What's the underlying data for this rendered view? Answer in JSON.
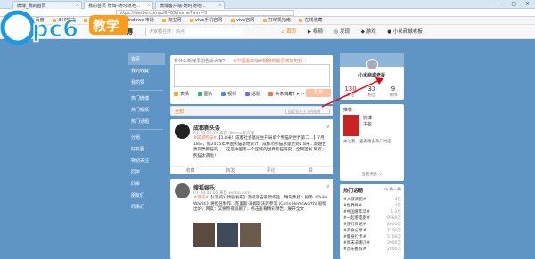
{
  "browser": {
    "tabs": [
      {
        "label": "微博_我的首页"
      },
      {
        "label": "我的首页 微博-随时随地…"
      },
      {
        "label": "微博客户端-随时随地…"
      }
    ],
    "url": "https://weibo.com/u/6465/home?wvr=5",
    "bookmarks": [
      "收藏",
      "百度",
      "360搜索",
      "MSN 导航",
      "Windows 市场",
      "淘宝网",
      "vivo手机官网",
      "vivo官网",
      "打印机指南",
      "在线收藏"
    ]
  },
  "watermark": {
    "text": "pc6",
    "badge": "教学",
    "badge_color": "#ff9c1b"
  },
  "weibo": {
    "logo_text": "微博",
    "search_placeholder": "大家都在搜：热点",
    "nav": [
      "首页",
      "视频",
      "发现",
      "游戏",
      "小米商城老板"
    ],
    "nav_active": 0
  },
  "sidebar": {
    "items": [
      "首页",
      "我的收藏",
      "我的赞",
      "热门微博",
      "热门视频",
      "热门话题",
      "分组",
      "好友圈",
      "特别关注",
      "同学",
      "同事",
      "朋友们",
      "同事们"
    ]
  },
  "compose": {
    "title": "有什么新鲜事想告诉大家？",
    "hot_topic": "#中国嘉年华#聊聊你最喜欢的电影→",
    "tools": [
      {
        "label": "表情",
        "color": "#f5a623"
      },
      {
        "label": "图片",
        "color": "#3cb371"
      },
      {
        "label": "视频",
        "color": "#4a90d9"
      },
      {
        "label": "话题",
        "color": "#7b68ee"
      },
      {
        "label": "头条文章",
        "color": "#eb7350"
      },
      {
        "label": "···",
        "color": "#cccccc"
      }
    ],
    "visibility": "公开",
    "publish_label": "发布"
  },
  "filter": {
    "label": "全部",
    "search_placeholder": "搜索我关注人的微博"
  },
  "posts": [
    {
      "name": "成都新头条",
      "meta": "07-18 08:11 来自 iPhone客户端",
      "keyword": "#成都熊猫#",
      "text": "【1.8米！成都社会基层生开局单个熊猫的世界第二…】7月18日，据2015年中国熊猫基地统计，成都市熊猫总量达到1.8米…超越世界同类熊猫的……这是中国第一个区域的世界熊猫研究…全网首发 网友：熊猫太萌啦！",
      "actions": [
        "收藏",
        "转发",
        "评论",
        "赞"
      ]
    },
    {
      "name": "搜狐娱乐",
      "meta": "07-18 08:05 来自 weibo.com",
      "keyword": "#漫威#",
      "text": "【《漫威》新剧发布】漫威宇宙最新作品，精彩集结：据悉《Taika Waititi》将担任制作…克里斯·海姆斯沃斯参演 (Chris Hemsworth) 剧情出炉，网友：又要熬夜追剧了，点击查看精彩预告…展开全文",
      "actions": [
        "收藏",
        "转发",
        "评论",
        "赞"
      ]
    }
  ],
  "profile": {
    "name": "小米商城老板",
    "stats": [
      {
        "num": "130",
        "label": "关注"
      },
      {
        "num": "33",
        "label": "粉丝"
      },
      {
        "num": "9",
        "label": "微博"
      }
    ]
  },
  "card": {
    "title": "推荐",
    "book_title": "微博",
    "book_sub": "书名",
    "desc": "关注我，查看更多热门动态",
    "more": "查看更多 ∨"
  },
  "topics": {
    "title": "热门话题",
    "swap": "换一换",
    "items": [
      {
        "t": "#大叔减肥#",
        "c": "3亿"
      },
      {
        "t": "#世界杯#",
        "c": "2亿"
      },
      {
        "t": "#中国嘉年华#",
        "c": "1.2亿"
      },
      {
        "t": "#一起看电影#",
        "c": "9580万"
      },
      {
        "t": "#旅行日记#",
        "c": "8600万"
      },
      {
        "t": "#美食分享#",
        "c": "7200万"
      },
      {
        "t": "#健身打卡#",
        "c": "5100万"
      },
      {
        "t": "#周末去哪儿#",
        "c": "3900万"
      },
      {
        "t": "#音乐推荐#",
        "c": "2800万"
      }
    ]
  }
}
